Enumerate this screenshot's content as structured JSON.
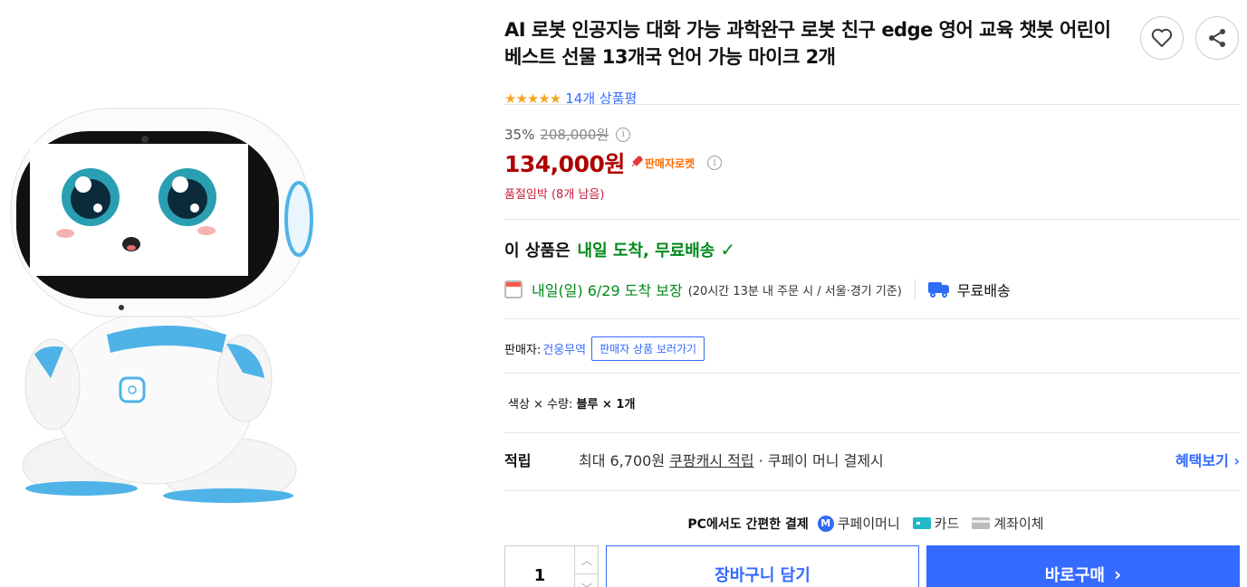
{
  "product": {
    "title": "AI 로봇 인공지능 대화 가능 과학완구 로봇 친구 edge 영어 교육 챗봇 어린이 베스트 선물 13개국 언어 가능 마이크 2개",
    "rating_stars": "★★★★★",
    "rating": 5,
    "review_count": "14개 상품평",
    "image_alt": "robot-product-image"
  },
  "actions": {
    "heart_icon": "heart-icon",
    "share_icon": "share-icon"
  },
  "price": {
    "discount_rate": "35%",
    "original_price": "208,000원",
    "sale_price": "134,000원",
    "badge_label": "판매자로켓",
    "info_glyph": "i",
    "stock_text": "품절임박 (8개 남음)"
  },
  "delivery": {
    "headline_prefix": "이 상품은",
    "headline_highlight": "내일 도착, 무료배송",
    "check_glyph": "✓",
    "arrival_text": "내일(일) 6/29 도착 보장",
    "arrival_note": "(20시간 13분  내 주문 시 / 서울·경기 기준)",
    "free_shipping": "무료배송"
  },
  "seller": {
    "label": "판매자:",
    "name": "건웅무역",
    "link_label": "판매자 상품 보러가기"
  },
  "option": {
    "label": "색상 × 수량:",
    "value": "블루 × 1개"
  },
  "reward": {
    "label": "적립",
    "text_prefix": "최대 6,700원",
    "text_link": "쿠팡캐시 적립",
    "text_suffix": "· 쿠페이 머니 결제시",
    "more_label": "혜택보기 ›"
  },
  "payment": {
    "title": "PC에서도 간편한 결제",
    "m_glyph": "M",
    "methods": [
      "쿠페이머니",
      "카드",
      "계좌이체"
    ]
  },
  "purchase": {
    "quantity": "1",
    "up_glyph": "︿",
    "down_glyph": "﹀",
    "cart_label": "장바구니 담기",
    "buy_label": "바로구매",
    "buy_chevron": "›"
  },
  "colors": {
    "accent": "#346aff",
    "price": "#ae0000",
    "delivery_green": "#00891a",
    "stock_red": "#c41e3a",
    "robot_blue": "#4fb3e8"
  }
}
